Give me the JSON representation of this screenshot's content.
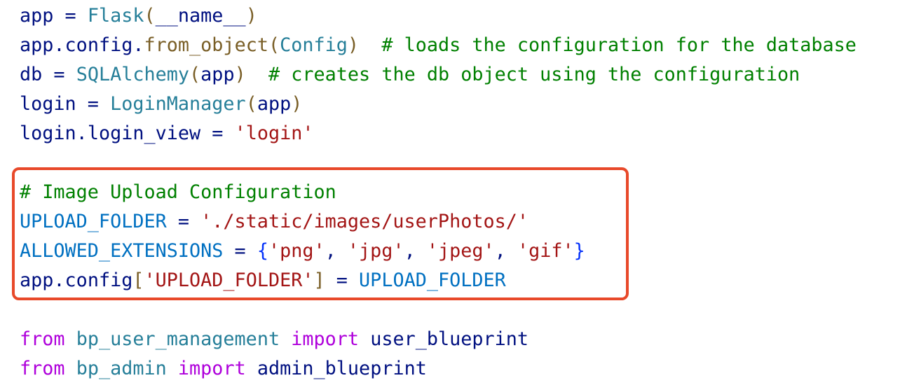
{
  "highlight": {
    "color": "#e8492a"
  },
  "lines": [
    [
      "app",
      " = ",
      "Flask",
      "(",
      "__name__",
      ")"
    ],
    [
      "app",
      ".",
      "config",
      ".",
      "from_object",
      "(",
      "Config",
      ")",
      "  # loads the configuration for the database"
    ],
    [
      "db",
      " = ",
      "SQLAlchemy",
      "(",
      "app",
      ")",
      "  # creates the db object using the configuration"
    ],
    [
      "login",
      " = ",
      "LoginManager",
      "(",
      "app",
      ")"
    ],
    [
      "login",
      ".",
      "login_view",
      " = ",
      "'login'"
    ],
    [],
    [
      "# Image Upload Configuration"
    ],
    [
      "UPLOAD_FOLDER",
      " = ",
      "'./static/images/userPhotos/'"
    ],
    [
      "ALLOWED_EXTENSIONS",
      " = ",
      "{",
      "'png'",
      ", ",
      "'jpg'",
      ", ",
      "'jpeg'",
      ", ",
      "'gif'",
      "}"
    ],
    [
      "app",
      ".",
      "config",
      "[",
      "'UPLOAD_FOLDER'",
      "]",
      " = ",
      "UPLOAD_FOLDER"
    ],
    [],
    [
      "from",
      " ",
      "bp_user_management",
      " ",
      "import",
      " ",
      "user_blueprint"
    ],
    [
      "from",
      " ",
      "bp_admin",
      " ",
      "import",
      " ",
      "admin_blueprint"
    ]
  ]
}
